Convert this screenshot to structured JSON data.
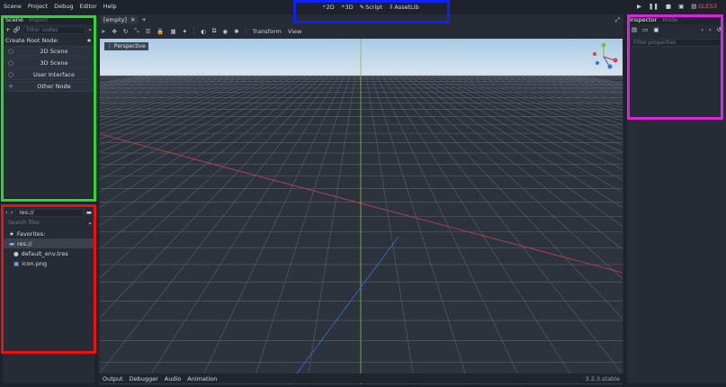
{
  "menu": [
    "Scene",
    "Project",
    "Debug",
    "Editor",
    "Help"
  ],
  "workspaces": [
    {
      "label": "2D",
      "icon": "2d-icon"
    },
    {
      "label": "3D",
      "icon": "3d-icon"
    },
    {
      "label": "Script",
      "icon": "script-icon"
    },
    {
      "label": "AssetLib",
      "icon": "assetlib-icon"
    }
  ],
  "renderer": "GLES3",
  "scene_dock": {
    "tabs": [
      "Scene",
      "Import"
    ],
    "filter_placeholder": "Filter nodes",
    "root_label": "Create Root Node:",
    "root_nodes": [
      "2D Scene",
      "3D Scene",
      "User Interface",
      "Other Node"
    ]
  },
  "filesystem": {
    "path": "res://",
    "search_placeholder": "Search files",
    "favorites": "Favorites:",
    "root": "res://",
    "files": [
      "default_env.tres",
      "icon.png"
    ]
  },
  "editor": {
    "scene_tab": "[empty]",
    "toolbar_menus": [
      "Transform",
      "View"
    ],
    "viewport_label": "Perspective",
    "bottom_tabs": [
      "Output",
      "Debugger",
      "Audio",
      "Animation"
    ],
    "version": "3.2.3.stable"
  },
  "inspector": {
    "tabs": [
      "Inspector",
      "Node"
    ],
    "filter_placeholder": "Filter properties"
  },
  "highlight_colors": {
    "green": "#22dd22",
    "red": "#ee1111",
    "blue": "#1122ee",
    "magenta": "#dd22dd"
  }
}
